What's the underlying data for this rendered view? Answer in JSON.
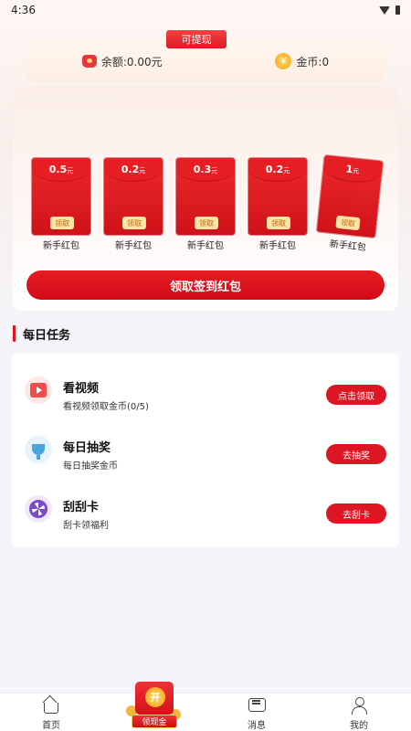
{
  "status_bar": {
    "time": "4:36"
  },
  "balance": {
    "withdraw_tag": "可提现",
    "balance_text": "余额:0.00元",
    "coins_text": "金币:0",
    "coin_symbol": "¥"
  },
  "red_packets": [
    {
      "amount": "0.5",
      "unit": "元",
      "claim": "领取",
      "label": "新手红包"
    },
    {
      "amount": "0.2",
      "unit": "元",
      "claim": "领取",
      "label": "新手红包"
    },
    {
      "amount": "0.3",
      "unit": "元",
      "claim": "领取",
      "label": "新手红包"
    },
    {
      "amount": "0.2",
      "unit": "元",
      "claim": "领取",
      "label": "新手红包"
    },
    {
      "amount": "1",
      "unit": "元",
      "claim": "领取",
      "label": "新手红包"
    }
  ],
  "signin_button": "领取签到红包",
  "daily_tasks": {
    "title": "每日任务",
    "items": [
      {
        "icon": "video-icon",
        "title": "看视频",
        "desc": "看视频领取金币(0/5)",
        "button": "点击领取"
      },
      {
        "icon": "trophy-icon",
        "title": "每日抽奖",
        "desc": "每日抽奖金币",
        "button": "去抽奖"
      },
      {
        "icon": "scratch-card-icon",
        "title": "刮刮卡",
        "desc": "刮卡领福利",
        "button": "去刮卡"
      }
    ]
  },
  "tabbar": {
    "home": "首页",
    "center": "领现金",
    "center_badge": "开",
    "messages": "消息",
    "me": "我的"
  },
  "colors": {
    "accent": "#dc1622",
    "background": "#f5f4f9"
  }
}
